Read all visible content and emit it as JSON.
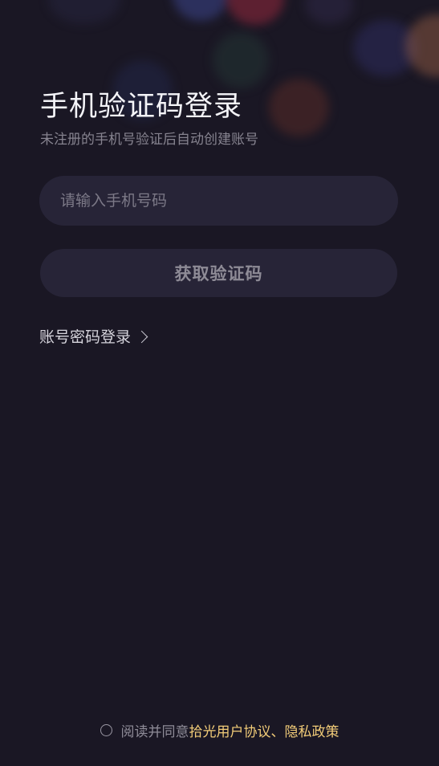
{
  "login": {
    "title": "手机验证码登录",
    "subtitle": "未注册的手机号验证后自动创建账号",
    "phone_placeholder": "请输入手机号码",
    "get_code_label": "获取验证码",
    "password_login_label": "账号密码登录"
  },
  "agreement": {
    "prefix": "阅读并同意",
    "user_agreement": "拾光用户协议",
    "separator": "、",
    "privacy_policy": "隐私政策",
    "checked": false
  },
  "colors": {
    "background": "#1a1724",
    "field": "#272437",
    "link": "#f2cc78"
  }
}
